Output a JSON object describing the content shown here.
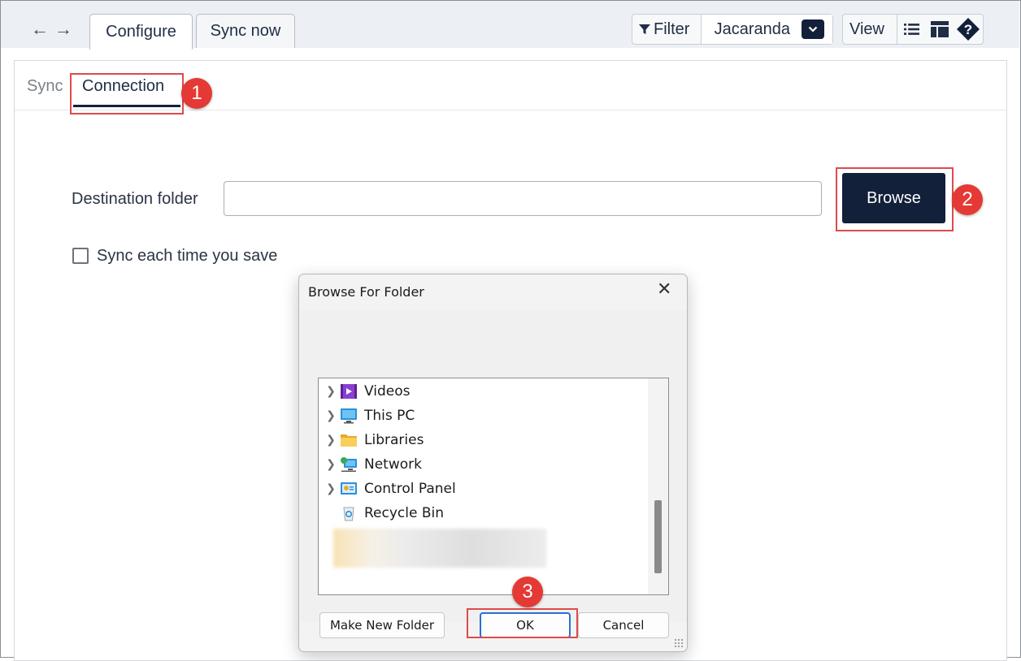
{
  "header": {
    "tabs": [
      {
        "label": "Configure"
      },
      {
        "label": "Sync now"
      }
    ],
    "toolbar": {
      "filter_label": "Filter",
      "selected_library": "Jacaranda",
      "view_label": "View"
    }
  },
  "subtabs": [
    {
      "label": "Sync"
    },
    {
      "label": "Connection"
    }
  ],
  "form": {
    "destination_label": "Destination folder",
    "destination_value": "",
    "browse_label": "Browse",
    "sync_on_save_label": "Sync each time you save"
  },
  "dialog": {
    "title": "Browse For Folder",
    "tree_items": [
      {
        "label": "Videos",
        "icon": "videos-folder-icon"
      },
      {
        "label": "This PC",
        "icon": "computer-icon"
      },
      {
        "label": "Libraries",
        "icon": "libraries-folder-icon"
      },
      {
        "label": "Network",
        "icon": "network-icon"
      },
      {
        "label": "Control Panel",
        "icon": "control-panel-icon"
      },
      {
        "label": "Recycle Bin",
        "icon": "recycle-bin-icon"
      }
    ],
    "buttons": {
      "make_new_folder": "Make New Folder",
      "ok": "OK",
      "cancel": "Cancel"
    }
  },
  "annotations": {
    "step1": "1",
    "step2": "2",
    "step3": "3"
  },
  "colors": {
    "accent_navy": "#12203a",
    "callout_red": "#e53935",
    "highlight_red": "#e04a4a"
  }
}
